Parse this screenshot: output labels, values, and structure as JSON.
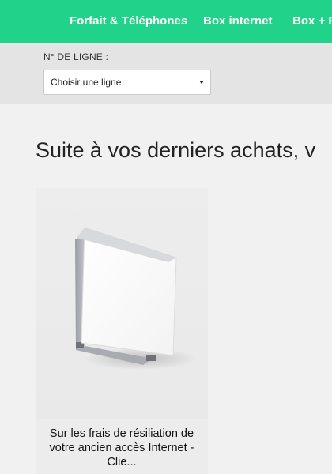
{
  "nav": {
    "items": [
      {
        "label": "Forfait & Téléphones"
      },
      {
        "label": "Box internet"
      },
      {
        "label": "Box + F"
      }
    ]
  },
  "line_selector": {
    "label": "N° DE LIGNE :",
    "selected": "Choisir une ligne"
  },
  "section": {
    "heading": "Suite à vos derniers achats, v"
  },
  "offer_card": {
    "text": "Sur les frais de résiliation de votre ancien accès Internet - Clie..."
  },
  "colors": {
    "nav_bg": "#21d38a",
    "line_bar_bg": "#e3e4e3",
    "page_bg": "#f1f1f1"
  }
}
